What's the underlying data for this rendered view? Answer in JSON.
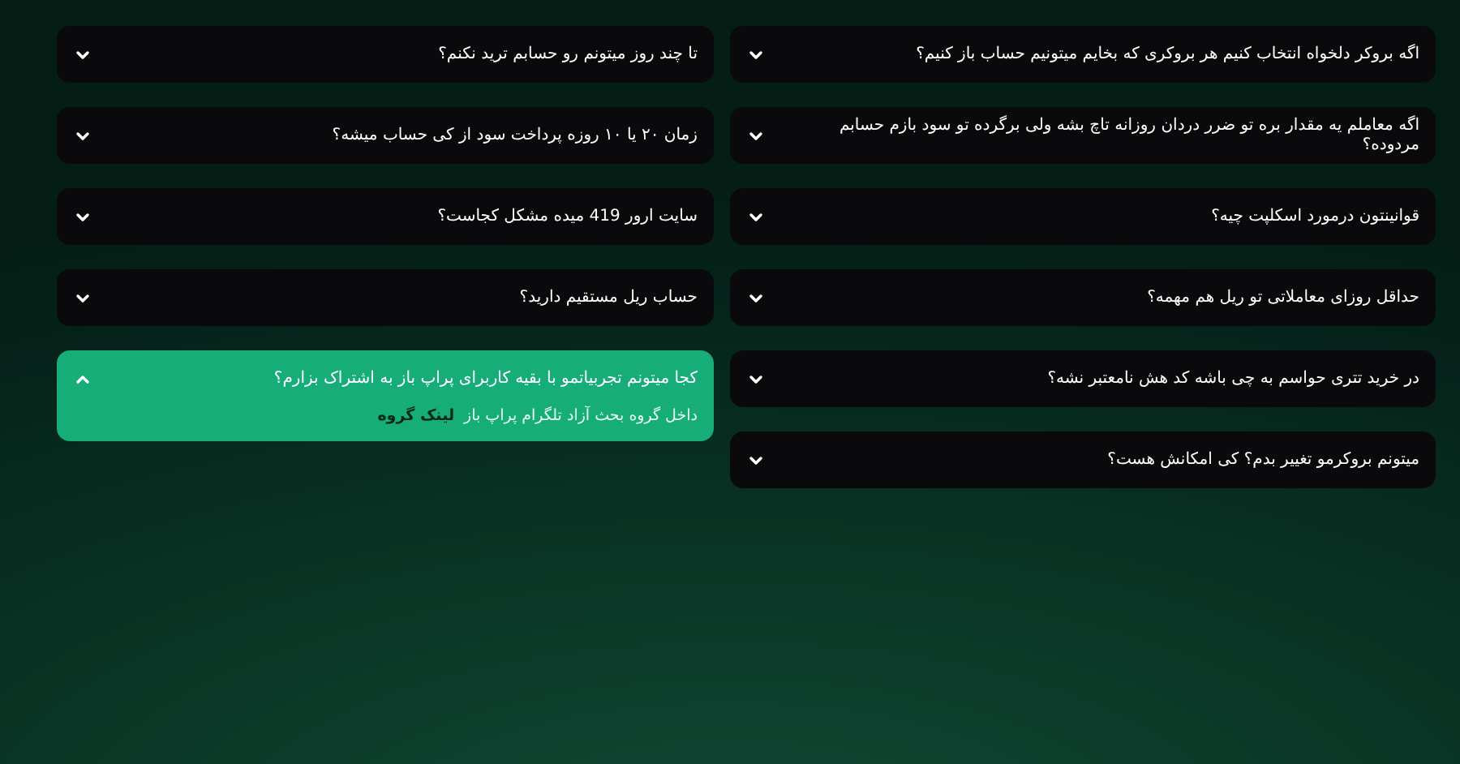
{
  "faq_columns": [
    {
      "items": [
        {
          "question": "اگه بروکر دلخواه انتخاب کنیم هر بروکری که بخایم میتونیم حساب باز کنیم؟",
          "expanded": false
        },
        {
          "question": "اگه معاملم یه مقدار بره تو ضرر دردان روزانه تاچ بشه ولی برگرده تو سود بازم حسابم مردوده؟",
          "expanded": false
        },
        {
          "question": "قوانینتون درمورد اسکلپت چیه؟",
          "expanded": false
        },
        {
          "question": "حداقل روزای معاملاتی تو ریل هم مهمه؟",
          "expanded": false
        },
        {
          "question": "در خرید تتری حواسم به چی باشه کد هش نامعتبر نشه؟",
          "expanded": false
        },
        {
          "question": "میتونم بروکرمو تغییر بدم؟ کی امکانش هست؟",
          "expanded": false
        }
      ]
    },
    {
      "items": [
        {
          "question": "تا چند روز میتونم رو حسابم ترید نکنم؟",
          "expanded": false
        },
        {
          "question": "زمان ۲۰ یا ۱۰ روزه پرداخت سود از کی حساب میشه؟",
          "expanded": false
        },
        {
          "question": "سایت ارور 419 میده مشکل کجاست؟",
          "expanded": false
        },
        {
          "question": "حساب ریل مستقیم دارید؟",
          "expanded": false
        },
        {
          "question": "کجا میتونم تجربیاتمو با بقیه کاربرای پراپ باز به اشتراک بزارم؟",
          "expanded": true,
          "answer": "داخل گروه بحث آزاد تلگرام پراپ باز",
          "link": "لینک گروه"
        }
      ]
    }
  ]
}
